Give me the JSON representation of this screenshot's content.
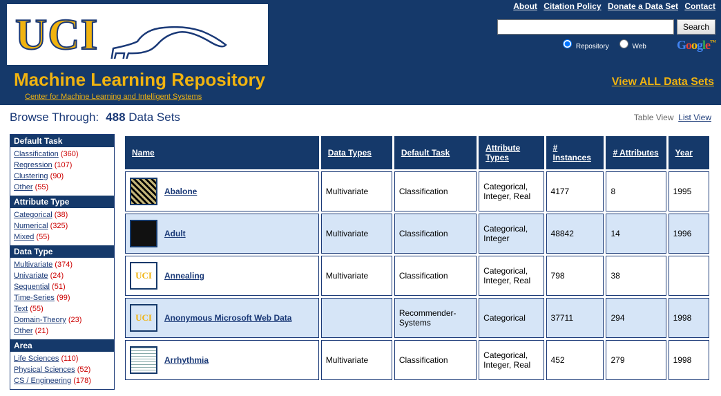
{
  "header_links": [
    {
      "label": "About"
    },
    {
      "label": "Citation Policy"
    },
    {
      "label": "Donate a Data Set"
    },
    {
      "label": "Contact"
    }
  ],
  "search": {
    "placeholder": "",
    "button": "Search",
    "radio": {
      "repo": "Repository",
      "web": "Web"
    }
  },
  "logo_text": "UCI",
  "repo_title": "Machine Learning Repository",
  "center_link": "Center for Machine Learning and Intelligent Systems",
  "view_all": "View ALL Data Sets",
  "browse": {
    "label": "Browse Through:",
    "count": "488",
    "suffix": "Data Sets",
    "table_view": "Table View",
    "list_view": "List View"
  },
  "sidebar": [
    {
      "title": "Default Task",
      "items": [
        {
          "label": "Classification",
          "count": "(360)"
        },
        {
          "label": "Regression",
          "count": "(107)"
        },
        {
          "label": "Clustering",
          "count": "(90)"
        },
        {
          "label": "Other",
          "count": "(55)"
        }
      ]
    },
    {
      "title": "Attribute Type",
      "items": [
        {
          "label": "Categorical",
          "count": "(38)"
        },
        {
          "label": "Numerical",
          "count": "(325)"
        },
        {
          "label": "Mixed",
          "count": "(55)"
        }
      ]
    },
    {
      "title": "Data Type",
      "items": [
        {
          "label": "Multivariate",
          "count": "(374)"
        },
        {
          "label": "Univariate",
          "count": "(24)"
        },
        {
          "label": "Sequential",
          "count": "(51)"
        },
        {
          "label": "Time-Series",
          "count": "(99)"
        },
        {
          "label": "Text",
          "count": "(55)"
        },
        {
          "label": "Domain-Theory",
          "count": "(23)"
        },
        {
          "label": "Other",
          "count": "(21)"
        }
      ]
    },
    {
      "title": "Area",
      "items": [
        {
          "label": "Life Sciences",
          "count": "(110)"
        },
        {
          "label": "Physical Sciences",
          "count": "(52)"
        },
        {
          "label": "CS / Engineering",
          "count": "(178)"
        }
      ]
    }
  ],
  "columns": {
    "name": "Name",
    "data_types": "Data Types",
    "default_task": "Default Task",
    "attribute_types": "Attribute Types",
    "instances": "# Instances",
    "attributes": "# Attributes",
    "year": "Year"
  },
  "datasets": [
    {
      "thumb": "grain",
      "name": "Abalone",
      "data_types": "Multivariate",
      "default_task": "Classification",
      "attribute_types": "Categorical, Integer, Real",
      "instances": "4177",
      "attributes": "8",
      "year": "1995"
    },
    {
      "thumb": "dark",
      "name": "Adult",
      "data_types": "Multivariate",
      "default_task": "Classification",
      "attribute_types": "Categorical, Integer",
      "instances": "48842",
      "attributes": "14",
      "year": "1996"
    },
    {
      "thumb": "uci",
      "name": "Annealing",
      "data_types": "Multivariate",
      "default_task": "Classification",
      "attribute_types": "Categorical, Integer, Real",
      "instances": "798",
      "attributes": "38",
      "year": ""
    },
    {
      "thumb": "uci",
      "name": "Anonymous Microsoft Web Data",
      "data_types": "",
      "default_task": "Recommender-Systems",
      "attribute_types": "Categorical",
      "instances": "37711",
      "attributes": "294",
      "year": "1998"
    },
    {
      "thumb": "wave",
      "name": "Arrhythmia",
      "data_types": "Multivariate",
      "default_task": "Classification",
      "attribute_types": "Categorical, Integer, Real",
      "instances": "452",
      "attributes": "279",
      "year": "1998"
    }
  ]
}
